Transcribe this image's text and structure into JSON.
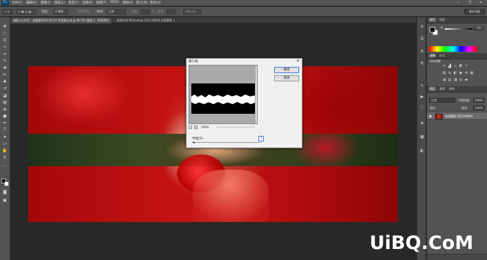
{
  "app": {
    "logo": "Ps",
    "menu": [
      "文件(F)",
      "编辑(E)",
      "图像(I)",
      "图层(L)",
      "类型(Y)",
      "选择(S)",
      "滤镜(T)",
      "3D(D)",
      "视图(V)",
      "窗口(W)",
      "帮助(H)"
    ],
    "window_controls": "— ❐ ✕"
  },
  "options": {
    "feather_label": "羽化:",
    "feather_value": "0 像素",
    "antialias_label": "消除锯齿",
    "style_label": "样式:",
    "style_value": "正常",
    "width_label": "宽度:",
    "height_label": "高度:",
    "refine_button": "调整边缘...",
    "workspace": "基本功能"
  },
  "tabs": [
    {
      "label": "海报 (公众号) · 封面图2022-05-27 优秀图.psd @ 66.7% (图层 1, RGB/8#)",
      "active": true
    },
    {
      "label": "新建文档-Photoshop 2022 08/04 快速蒙版 × ",
      "active": false
    }
  ],
  "dialog": {
    "title": "最小值",
    "close": "✕",
    "ok": "确定",
    "cancel": "取消",
    "zoom_minus": "−",
    "zoom_plus": "+",
    "zoom_percent": "100%",
    "param_label": "半径(R):",
    "param_value": "1",
    "param_unit": "像素"
  },
  "panels": {
    "color_tabs": [
      {
        "label": "颜色",
        "active": true
      },
      {
        "label": "色板",
        "active": false
      }
    ],
    "k_label": "K",
    "k_value": "100",
    "adjust_tabs": [
      {
        "label": "调整",
        "active": true
      },
      {
        "label": "样式",
        "active": false
      }
    ],
    "adjust_title": "添加调整",
    "layer_tabs": [
      {
        "label": "图层",
        "active": true
      },
      {
        "label": "通道",
        "active": false
      },
      {
        "label": "路径",
        "active": false
      }
    ],
    "blend_mode": "正常",
    "opacity_label": "不透明度:",
    "opacity_value": "100%",
    "lock_label": "锁定:",
    "fill_label": "填充:",
    "fill_value": "100%",
    "layer_name": "快速蒙版 2022/08/04"
  },
  "watermark": "UiBQ.CoM"
}
